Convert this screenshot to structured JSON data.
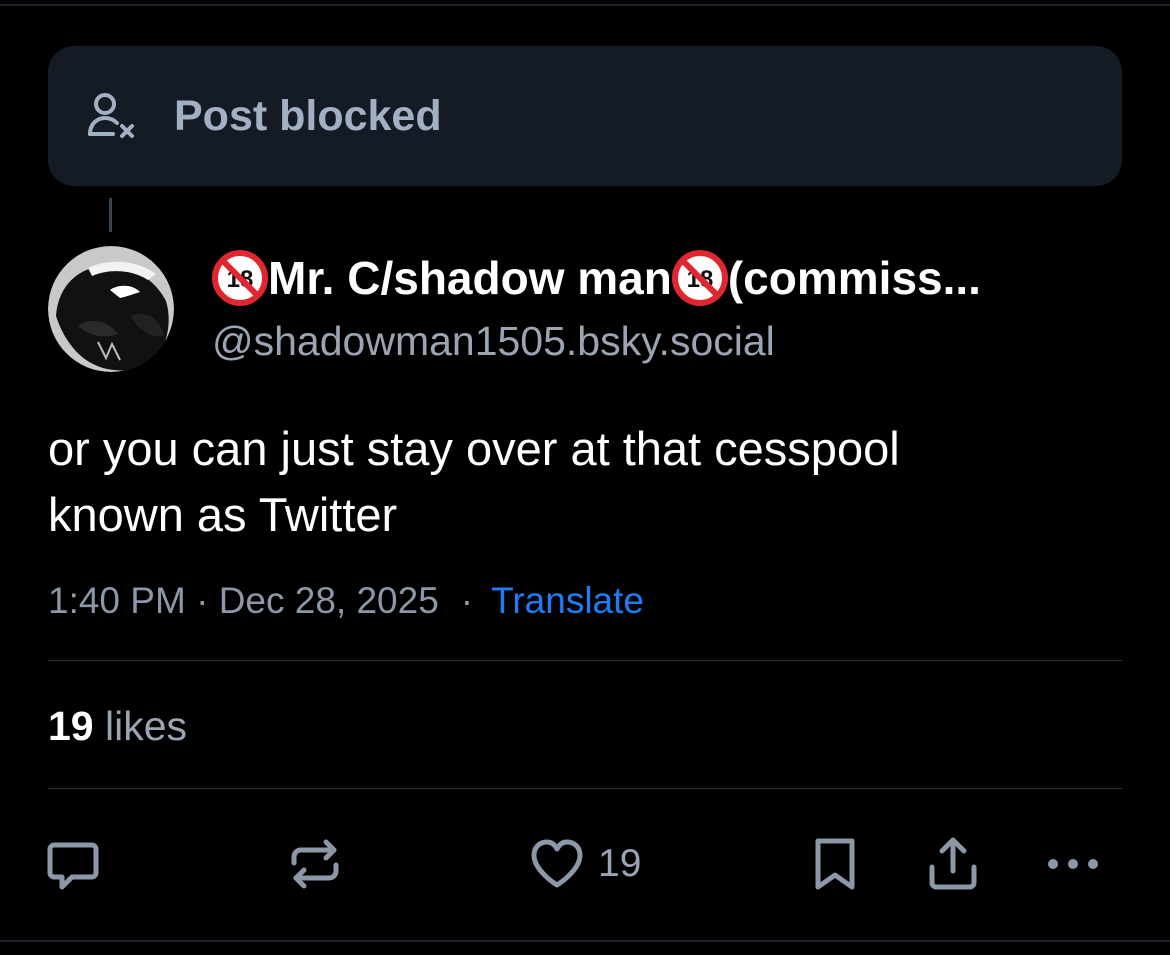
{
  "blocked_notice": {
    "label": "Post blocked",
    "icon": "person-x-icon"
  },
  "author": {
    "display_name": "Mr. C/shadow man",
    "display_name_suffix": " (commiss...",
    "handle": "@shadowman1505.bsky.social",
    "badge_icon": "no-under-18-icon"
  },
  "post": {
    "text_line1": "or you can just stay over at that cesspool",
    "text_line2": "known as Twitter",
    "time": "1:40 PM",
    "date_sep": " · ",
    "date": "Dec 28, 2025",
    "meta_sep": "·",
    "translate_label": "Translate"
  },
  "stats": {
    "likes_count": "19",
    "likes_label": " likes"
  },
  "actions": {
    "reply_icon": "reply-icon",
    "repost_icon": "repost-icon",
    "like_icon": "heart-icon",
    "like_count": "19",
    "bookmark_icon": "bookmark-icon",
    "share_icon": "share-icon",
    "more_icon": "more-icon"
  },
  "colors": {
    "background": "#000000",
    "card": "#151b24",
    "link": "#1f7cf5",
    "muted": "#9aa4b2",
    "badge_red": "#e0262f"
  }
}
